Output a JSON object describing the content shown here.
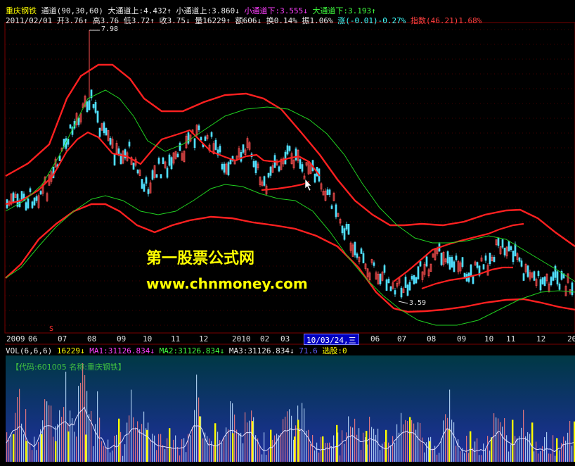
{
  "header": {
    "stock_name": "重庆钢铁",
    "indicator": "通道(90,30,60)",
    "big_upper": "大通道上:4.432↑",
    "small_upper": "小通道上:3.860↓",
    "small_lower": "小通道下:3.555↓",
    "big_lower": "大通道下:3.193↑"
  },
  "quote": {
    "date": "2011/02/01",
    "open": "开3.76↑",
    "high": "高3.76",
    "low": "低3.72↑",
    "close": "收3.75↓",
    "volume": "量16229↑",
    "amount": "额606↓",
    "turnover": "换0.14%",
    "amplitude": "振1.06%",
    "change": "涨(-0.01)-0.27%",
    "index": "指数(46.21)1.68%"
  },
  "watermark": {
    "title": "第一股票公式网",
    "url": "www.chnmoney.com"
  },
  "date_axis": {
    "ticks": [
      "2009",
      "06",
      "07",
      "08",
      "09",
      "10",
      "11",
      "12",
      "2010",
      "02",
      "03",
      "06",
      "07",
      "08",
      "09",
      "10",
      "11",
      "12",
      "20"
    ],
    "cursor_label": "10/03/24,三",
    "marker": "S"
  },
  "volume_header": {
    "vol": "VOL(6,6,6)",
    "value": "16229↓",
    "ma1": "MA1:31126.834↓",
    "ma2": "MA2:31126.834↓",
    "ma3": "MA3:31126.834↓",
    "ma3_tail": "71.6",
    "select": "选股:0"
  },
  "code_line": "【代码:601005 名称:重庆钢铁】",
  "chart_data": {
    "type": "line",
    "title": "重庆钢铁 通道(90,30,60)",
    "y_range_estimated": [
      2.8,
      8.2
    ],
    "x_range": [
      "2009",
      "2011"
    ],
    "annotations": [
      {
        "label": "7.98",
        "note": "high point"
      },
      {
        "label": "3.59",
        "note": "low point"
      }
    ],
    "series": [
      {
        "name": "大通道上",
        "color": "#ff2020",
        "last_value": 4.432
      },
      {
        "name": "小通道上",
        "color": "#00c000",
        "last_value": 3.86
      },
      {
        "name": "小通道下",
        "color": "#00c000",
        "last_value": 3.555
      },
      {
        "name": "大通道下",
        "color": "#ff2020",
        "last_value": 3.193
      }
    ]
  },
  "colors": {
    "background": "#000000",
    "volume_panel_top": "#003844",
    "volume_panel_bottom": "#1f2fa0",
    "up_candle": "#ff5050",
    "down_candle": "#50e0ff",
    "channel_red": "#ff2020",
    "channel_green": "#00c000",
    "highlight_bar": "#ffff00"
  }
}
